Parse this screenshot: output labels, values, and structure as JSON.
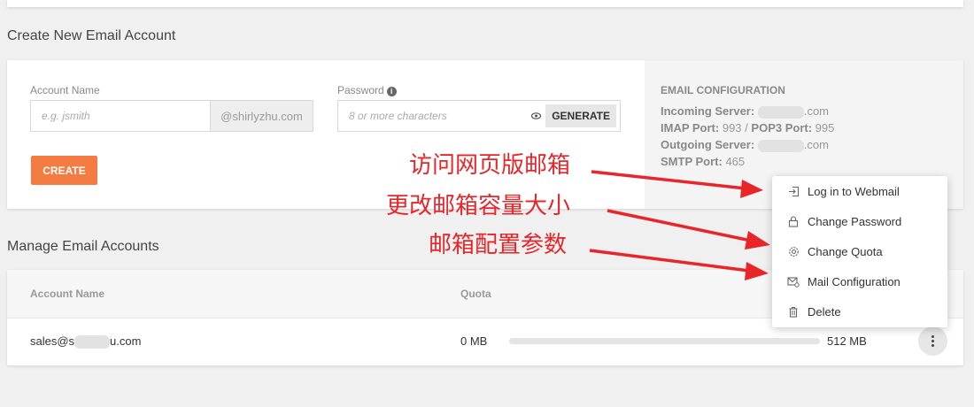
{
  "create_section": {
    "title": "Create New Email Account",
    "account_name_label": "Account Name",
    "account_name_placeholder": "e.g. jsmith",
    "domain_suffix": "@shirlyzhu.com",
    "password_label": "Password",
    "password_placeholder": "8 or more characters",
    "generate_label": "GENERATE",
    "create_label": "CREATE"
  },
  "email_config": {
    "title": "EMAIL CONFIGURATION",
    "incoming_label": "Incoming Server:",
    "incoming_suffix": ".com",
    "imap_label": "IMAP Port:",
    "imap_value": "993",
    "separator": "/",
    "pop3_label": "POP3 Port:",
    "pop3_value": "995",
    "outgoing_label": "Outgoing Server:",
    "outgoing_suffix": ".com",
    "smtp_label": "SMTP Port:",
    "smtp_value": "465"
  },
  "manage_section": {
    "title": "Manage Email Accounts",
    "col_account": "Account Name",
    "col_quota": "Quota",
    "rows": [
      {
        "account_prefix": "sales@s",
        "account_suffix": "u.com",
        "used": "0 MB",
        "limit": "512 MB",
        "fill_fraction": 0.0
      }
    ]
  },
  "menu": {
    "items": [
      {
        "label": "Log in to Webmail",
        "icon": "login-icon"
      },
      {
        "label": "Change Password",
        "icon": "lock-icon"
      },
      {
        "label": "Change Quota",
        "icon": "gear-icon"
      },
      {
        "label": "Mail Configuration",
        "icon": "mail-config-icon"
      },
      {
        "label": "Delete",
        "icon": "trash-icon"
      }
    ]
  },
  "annotations": {
    "webmail": "访问网页版邮箱",
    "quota": "更改邮箱容量大小",
    "config": "邮箱配置参数"
  },
  "colors": {
    "accent": "#f47b42",
    "annotation": "#e8262a"
  }
}
